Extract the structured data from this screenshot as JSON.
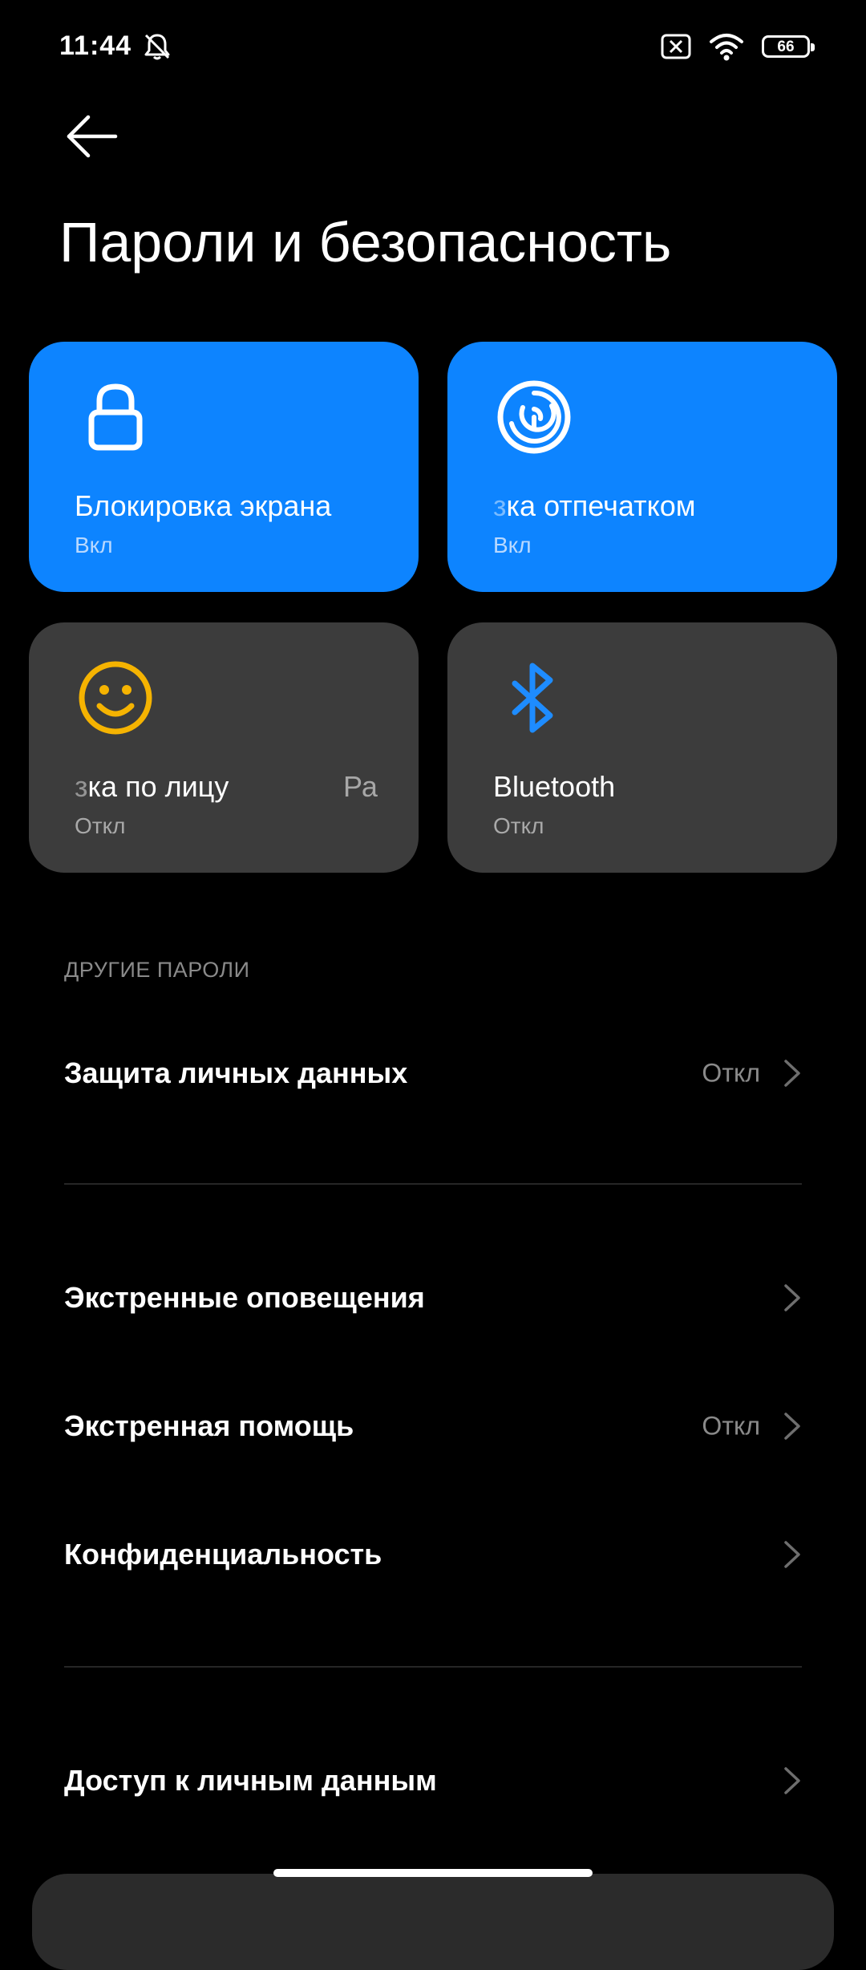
{
  "status_bar": {
    "time": "11:44",
    "battery_level": "66",
    "icons": [
      "bell-off-icon",
      "sim-no-service-icon",
      "wifi-icon",
      "battery-icon"
    ]
  },
  "header": {
    "title": "Пароли и безопасность",
    "back_icon": "arrow-left-icon"
  },
  "tiles": [
    {
      "label": "Блокировка экрана",
      "status": "Вкл",
      "icon": "lock-icon",
      "color": "#0d84ff"
    },
    {
      "label_faded": "з",
      "label": "ка отпечатком",
      "status": "Вкл",
      "icon": "fingerprint-icon",
      "color": "#0d84ff"
    },
    {
      "label_faded": "з",
      "label": "ка по лицу",
      "label_extra": "Ра",
      "status": "Откл",
      "icon": "smiley-face-icon",
      "color": "#3c3c3c"
    },
    {
      "label": "Bluetooth",
      "status": "Откл",
      "icon": "bluetooth-icon",
      "color": "#3c3c3c"
    }
  ],
  "section": {
    "header": "ДРУГИЕ ПАРОЛИ"
  },
  "rows": [
    {
      "label": "Защита личных данных",
      "value": "Откл"
    },
    {
      "label": "Экстренные оповещения",
      "value": ""
    },
    {
      "label": "Экстренная помощь",
      "value": "Откл"
    },
    {
      "label": "Конфиденциальность",
      "value": ""
    },
    {
      "label": "Доступ к личным данным",
      "value": ""
    }
  ],
  "colors": {
    "accent": "#0d84ff",
    "tile_gray": "#3c3c3c",
    "face_icon": "#f5b301",
    "bluetooth_icon": "#1e8cff",
    "muted_text": "#8a8a8a"
  }
}
